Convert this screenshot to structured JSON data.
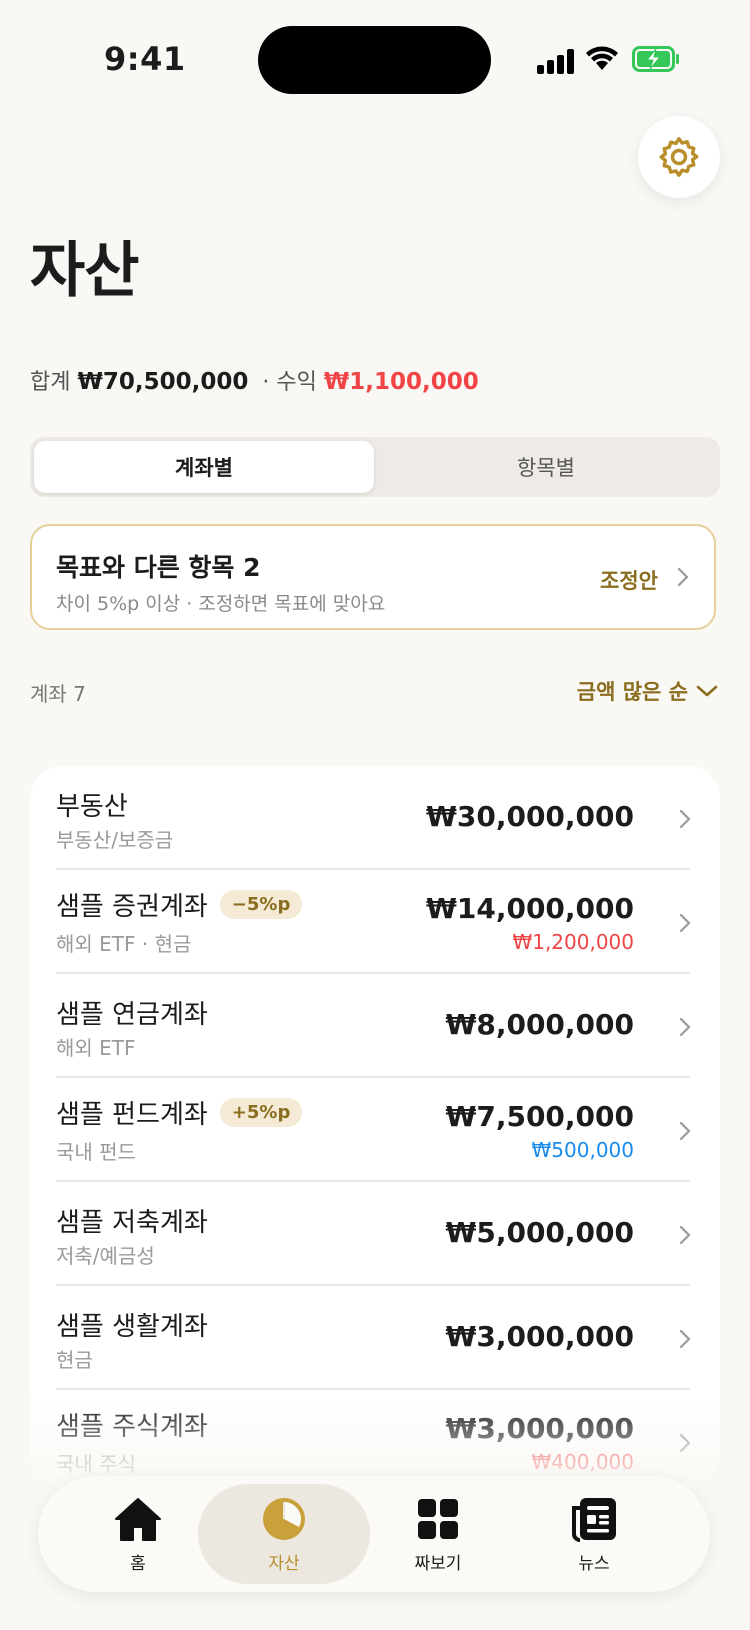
{
  "status_bar": {
    "time": "9:41"
  },
  "header": {
    "title": "자산"
  },
  "summary": {
    "total_label": "합계",
    "total_value": "₩70,500,000",
    "separator": "·",
    "profit_label": "수익",
    "profit_value": "₩1,100,000"
  },
  "segment": {
    "tabs": [
      {
        "label": "계좌별",
        "selected": true
      },
      {
        "label": "항목별",
        "selected": false
      }
    ]
  },
  "alert": {
    "title": "목표와 다른 항목 2",
    "subtitle": "차이 5%p 이상 · 조정하면 목표에 맞아요",
    "action": "조정안"
  },
  "list_header": {
    "count_label": "계좌 7",
    "sort_label": "금액 많은 순"
  },
  "accounts": [
    {
      "name": "부동산",
      "sub": "부동산/보증금",
      "amount": "₩30,000,000",
      "badge": "",
      "delta": ""
    },
    {
      "name": "샘플 증권계좌",
      "sub": "해외 ETF · 현금",
      "amount": "₩14,000,000",
      "badge": "−5%p",
      "delta": "₩1,200,000",
      "delta_color": "#f04447"
    },
    {
      "name": "샘플 연금계좌",
      "sub": "해외 ETF",
      "amount": "₩8,000,000",
      "badge": "",
      "delta": ""
    },
    {
      "name": "샘플 펀드계좌",
      "sub": "국내 펀드",
      "amount": "₩7,500,000",
      "badge": "+5%p",
      "delta": "₩500,000",
      "delta_color": "#1a8cf0"
    },
    {
      "name": "샘플 저축계좌",
      "sub": "저축/예금성",
      "amount": "₩5,000,000",
      "badge": "",
      "delta": ""
    },
    {
      "name": "샘플 생활계좌",
      "sub": "현금",
      "amount": "₩3,000,000",
      "badge": "",
      "delta": ""
    },
    {
      "name": "샘플 주식계좌",
      "sub": "국내 주식",
      "amount": "₩3,000,000",
      "badge": "",
      "delta": "₩400,000",
      "delta_color": "#f04447"
    }
  ],
  "tabbar": {
    "items": [
      {
        "label": "홈",
        "icon": "home-icon"
      },
      {
        "label": "자산",
        "icon": "pie-chart-icon",
        "selected": true
      },
      {
        "label": "짜보기",
        "icon": "grid-icon"
      },
      {
        "label": "뉴스",
        "icon": "newspaper-icon"
      }
    ]
  },
  "colors": {
    "accent": "#b98f2b",
    "profit_red": "#f04447",
    "loss_blue": "#1a8cf0",
    "badge_text": "#8b6d1f"
  }
}
